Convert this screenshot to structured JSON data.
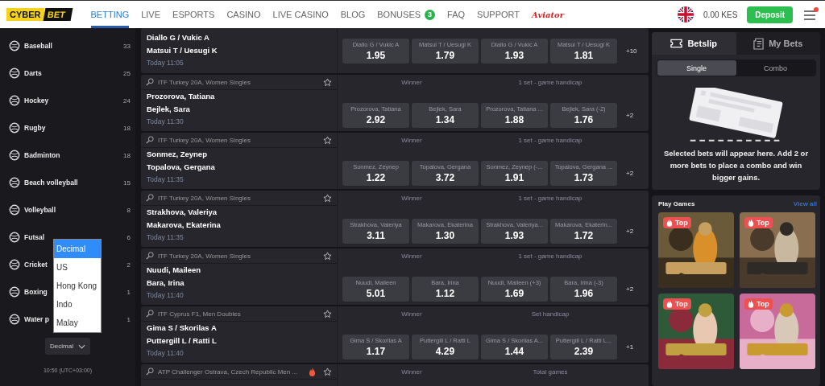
{
  "header": {
    "logo": [
      "CYBER",
      "BET"
    ],
    "nav": [
      {
        "label": "BETTING",
        "selected": true,
        "kind": "text"
      },
      {
        "label": "LIVE",
        "selected": false,
        "kind": "text"
      },
      {
        "label": "ESPORTS",
        "selected": false,
        "kind": "text"
      },
      {
        "label": "CASINO",
        "selected": false,
        "kind": "text"
      },
      {
        "label": "LIVE CASINO",
        "selected": false,
        "kind": "text"
      },
      {
        "label": "BLOG",
        "selected": false,
        "kind": "text"
      },
      {
        "label": "BONUSES",
        "selected": false,
        "kind": "text",
        "badge": "3"
      },
      {
        "label": "FAQ",
        "selected": false,
        "kind": "text"
      },
      {
        "label": "SUPPORT",
        "selected": false,
        "kind": "text"
      },
      {
        "label": "Aviator",
        "selected": false,
        "kind": "brand"
      }
    ],
    "balance": "0.00 KES",
    "deposit": "Deposit",
    "menu_notification": true
  },
  "sidebar": {
    "sports": [
      {
        "name": "Baseball",
        "count": "33"
      },
      {
        "name": "Darts",
        "count": "25"
      },
      {
        "name": "Hockey",
        "count": "24"
      },
      {
        "name": "Rugby",
        "count": "18"
      },
      {
        "name": "Badminton",
        "count": "18"
      },
      {
        "name": "Beach volleyball",
        "count": "15"
      },
      {
        "name": "Volleyball",
        "count": "8"
      },
      {
        "name": "Futsal",
        "count": "6"
      },
      {
        "name": "Cricket",
        "count": "2"
      },
      {
        "name": "Boxing",
        "count": "1"
      },
      {
        "name": "Water p",
        "count": "1"
      }
    ],
    "odds_format": {
      "value": "Decimal",
      "expanded": true,
      "options": [
        {
          "label": "Decimal",
          "selected": true
        },
        {
          "label": "US",
          "selected": false
        },
        {
          "label": "Hong Kong",
          "selected": false
        },
        {
          "label": "Indo",
          "selected": false
        },
        {
          "label": "Malay",
          "selected": false
        }
      ]
    },
    "clock": "10:50 (UTC+03:00)"
  },
  "matches": [
    {
      "teams": [
        "Diallo G / Vukic A",
        "Matsui T / Uesugi K"
      ],
      "time": "Today 11:05",
      "odds": [
        {
          "label": "Diallo G / Vukic A",
          "price": "1.95"
        },
        {
          "label": "Matsui T / Uesugi K",
          "price": "1.79"
        },
        {
          "label": "Diallo G / Vukic A",
          "price": "1.93"
        },
        {
          "label": "Matsui T / Uesugi K",
          "price": "1.81"
        }
      ],
      "more": "+10"
    },
    {
      "tournament": "ITF Turkey 20A, Women Singles",
      "hot": false,
      "teams": [
        "Prozorova, Tatiana",
        "Bejlek, Sara"
      ],
      "time": "Today 11:30",
      "markets": [
        "Winner",
        "1 set - game handicap"
      ],
      "odds": [
        {
          "label": "Prozorova, Tatiana",
          "price": "2.92"
        },
        {
          "label": "Bejlek, Sara",
          "price": "1.34"
        },
        {
          "label": "Prozorova, Tatiana ...",
          "price": "1.88"
        },
        {
          "label": "Bejlek, Sara (-2)",
          "price": "1.76"
        }
      ],
      "more": "+2"
    },
    {
      "tournament": "ITF Turkey 20A, Women Singles",
      "hot": false,
      "teams": [
        "Sonmez, Zeynep",
        "Topalova, Gergana"
      ],
      "time": "Today 11:35",
      "markets": [
        "Winner",
        "1 set - game handicap"
      ],
      "odds": [
        {
          "label": "Sonmez, Zeynep",
          "price": "1.22"
        },
        {
          "label": "Topalova, Gergana",
          "price": "3.72"
        },
        {
          "label": "Sonmez, Zeynep (-...",
          "price": "1.91"
        },
        {
          "label": "Topalova, Gergana ...",
          "price": "1.73"
        }
      ],
      "more": "+2"
    },
    {
      "tournament": "ITF Turkey 20A, Women Singles",
      "hot": false,
      "teams": [
        "Strakhova, Valeriya",
        "Makarova, Ekaterina"
      ],
      "time": "Today 11:35",
      "markets": [
        "Winner",
        "1 set - game handicap"
      ],
      "odds": [
        {
          "label": "Strakhova, Valeriya",
          "price": "3.11"
        },
        {
          "label": "Makarova, Ekaterina",
          "price": "1.30"
        },
        {
          "label": "Strakhova, Valeriya...",
          "price": "1.93"
        },
        {
          "label": "Makarova, Ekaterin...",
          "price": "1.72"
        }
      ],
      "more": "+2"
    },
    {
      "tournament": "ITF Turkey 20A, Women Singles",
      "hot": false,
      "teams": [
        "Nuudi, Maileen",
        "Bara, Irina"
      ],
      "time": "Today 11:40",
      "markets": [
        "Winner",
        "1 set - game handicap"
      ],
      "odds": [
        {
          "label": "Nuudi, Maileen",
          "price": "5.01"
        },
        {
          "label": "Bara, Irina",
          "price": "1.12"
        },
        {
          "label": "Nuudi, Maileen (+3)",
          "price": "1.69"
        },
        {
          "label": "Bara, Irina (-3)",
          "price": "1.96"
        }
      ],
      "more": "+2"
    },
    {
      "tournament": "ITF Cyprus F1, Men Doubles",
      "hot": false,
      "teams": [
        "Gima S / Skorilas A",
        "Puttergill L / Ratti L"
      ],
      "time": "Today 11:40",
      "markets": [
        "Winner",
        "Set handicap"
      ],
      "odds": [
        {
          "label": "Gima S / Skorilas A",
          "price": "1.17"
        },
        {
          "label": "Puttergill L / Ratti L",
          "price": "4.29"
        },
        {
          "label": "Gima S / Skorilas A...",
          "price": "1.44"
        },
        {
          "label": "Puttergill L / Ratti L...",
          "price": "2.39"
        }
      ],
      "more": "+1"
    },
    {
      "tournament": "ATP Challenger Ostrava, Czech Republic Men ...",
      "hot": true,
      "markets": [
        "Winner",
        "Total games"
      ]
    }
  ],
  "betslip": {
    "tabs": [
      {
        "label": "Betslip",
        "selected": true
      },
      {
        "label": "My Bets",
        "selected": false
      }
    ],
    "bet_types": [
      {
        "label": "Single",
        "selected": true
      },
      {
        "label": "Combo",
        "selected": false
      }
    ],
    "message": "Selected bets will appear here. Add 2 or more bets to place a combo and win bigger gains."
  },
  "games": {
    "title": "Play Games",
    "view_all": "View all",
    "items": [
      {
        "badge": "Top",
        "kind": "picture"
      },
      {
        "badge": "Top",
        "kind": "picture"
      },
      {
        "badge": "Top",
        "kind": "picture"
      },
      {
        "badge": "Top",
        "kind": "picture"
      }
    ]
  }
}
